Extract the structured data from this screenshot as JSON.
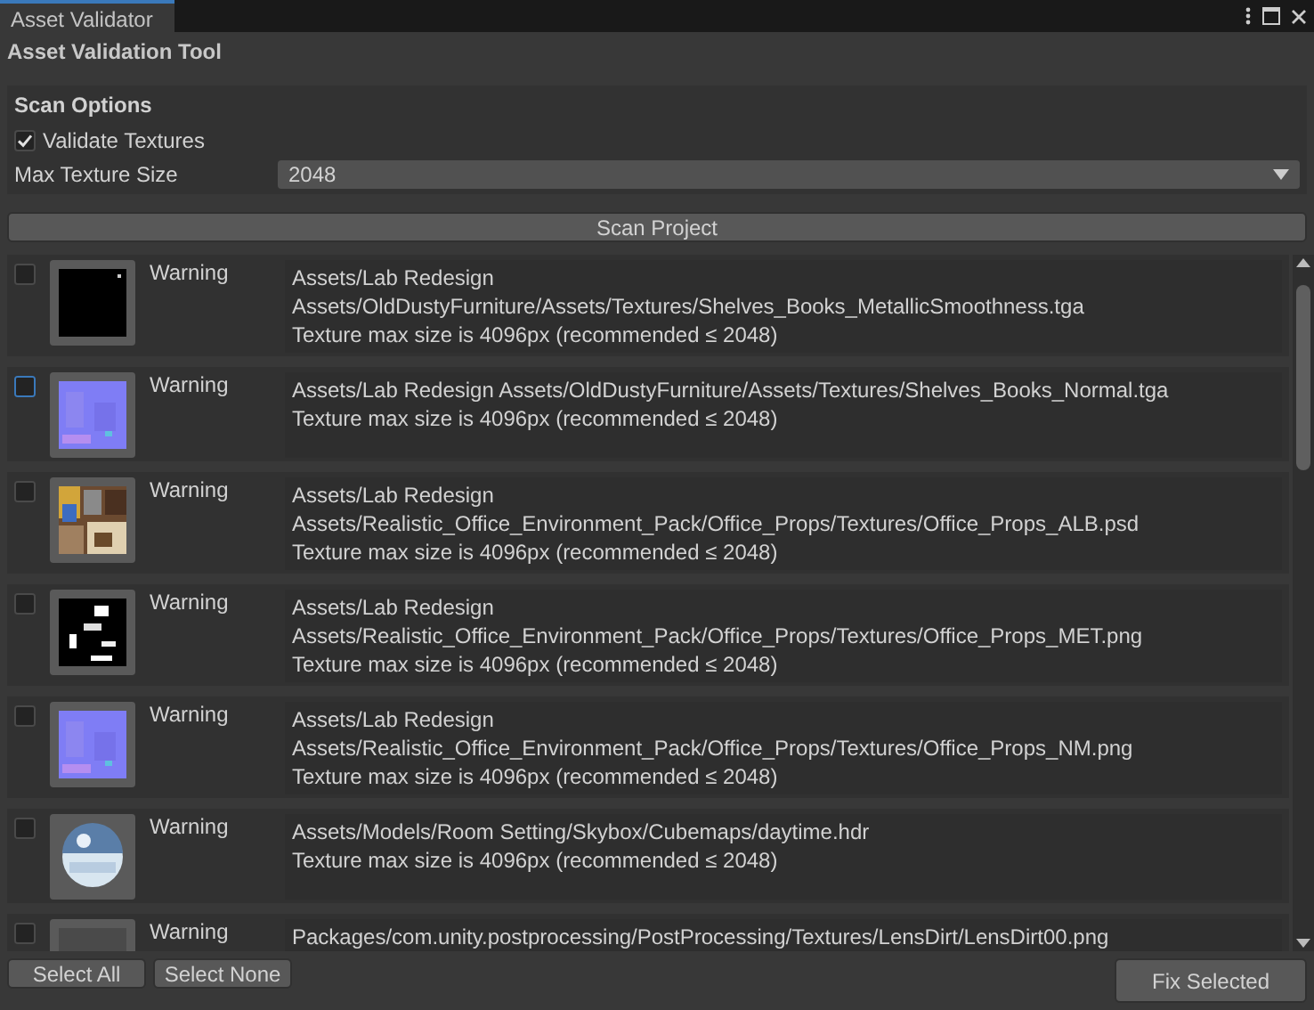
{
  "window": {
    "tab": "Asset Validator",
    "title": "Asset Validation Tool"
  },
  "scan_options": {
    "heading": "Scan Options",
    "validate_textures": {
      "label": "Validate Textures",
      "checked": true
    },
    "max_texture_size": {
      "label": "Max Texture Size",
      "value": "2048"
    }
  },
  "scan_button": "Scan Project",
  "results": [
    {
      "checked": false,
      "focused": false,
      "severity": "Warning",
      "lines": [
        "Assets/Lab Redesign",
        "Assets/OldDustyFurniture/Assets/Textures/Shelves_Books_MetallicSmoothness.tga",
        "Texture max size is 4096px (recommended ≤ 2048)"
      ]
    },
    {
      "checked": false,
      "focused": true,
      "severity": "Warning",
      "lines": [
        "Assets/Lab Redesign Assets/OldDustyFurniture/Assets/Textures/Shelves_Books_Normal.tga",
        "Texture max size is 4096px (recommended ≤ 2048)"
      ]
    },
    {
      "checked": false,
      "focused": false,
      "severity": "Warning",
      "lines": [
        "Assets/Lab Redesign",
        "Assets/Realistic_Office_Environment_Pack/Office_Props/Textures/Office_Props_ALB.psd",
        "Texture max size is 4096px (recommended ≤ 2048)"
      ]
    },
    {
      "checked": false,
      "focused": false,
      "severity": "Warning",
      "lines": [
        "Assets/Lab Redesign",
        "Assets/Realistic_Office_Environment_Pack/Office_Props/Textures/Office_Props_MET.png",
        "Texture max size is 4096px (recommended ≤ 2048)"
      ]
    },
    {
      "checked": false,
      "focused": false,
      "severity": "Warning",
      "lines": [
        "Assets/Lab Redesign",
        "Assets/Realistic_Office_Environment_Pack/Office_Props/Textures/Office_Props_NM.png",
        "Texture max size is 4096px (recommended ≤ 2048)"
      ]
    },
    {
      "checked": false,
      "focused": false,
      "severity": "Warning",
      "lines": [
        "Assets/Models/Room Setting/Skybox/Cubemaps/daytime.hdr",
        "Texture max size is 4096px (recommended ≤ 2048)"
      ]
    },
    {
      "checked": false,
      "focused": false,
      "severity": "Warning",
      "lines": [
        "Packages/com.unity.postprocessing/PostProcessing/Textures/LensDirt/LensDirt00.png"
      ]
    }
  ],
  "footer": {
    "select_all": "Select All",
    "select_none": "Select None",
    "fix_selected": "Fix Selected"
  }
}
